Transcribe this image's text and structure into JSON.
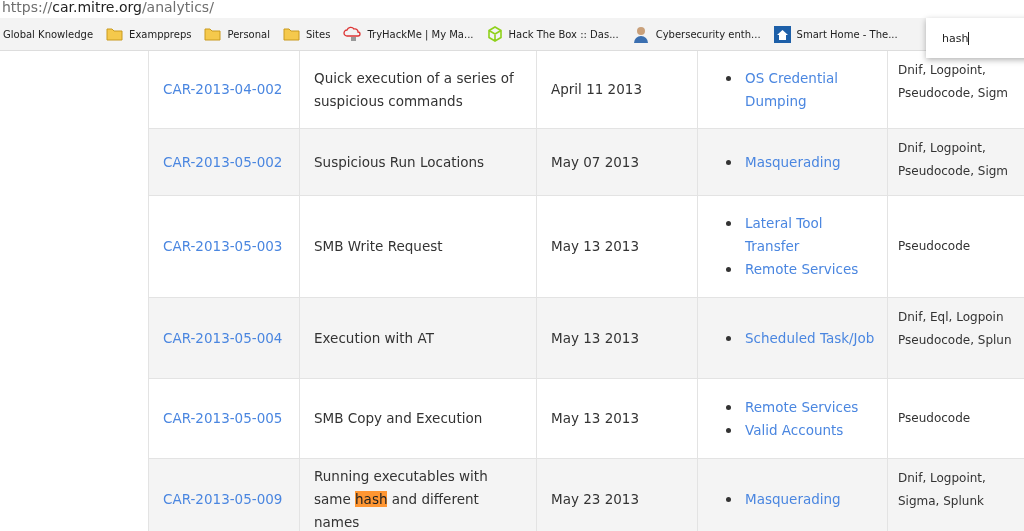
{
  "address_bar": {
    "scheme": "https://",
    "host": "car.mitre.org",
    "path": "/analytics/"
  },
  "bookmarks": [
    {
      "kind": "none",
      "label": "Global Knowledge"
    },
    {
      "kind": "folder",
      "label": "Examppreps"
    },
    {
      "kind": "folder",
      "label": "Personal"
    },
    {
      "kind": "folder",
      "label": "Sites"
    },
    {
      "kind": "cloud",
      "label": "TryHackMe | My Ma..."
    },
    {
      "kind": "cube",
      "label": "Hack The Box :: Das..."
    },
    {
      "kind": "avatar",
      "label": "Cybersecurity enth..."
    },
    {
      "kind": "house",
      "label": "Smart Home - The..."
    }
  ],
  "find_bar": {
    "value": "hash"
  },
  "table": {
    "rows": [
      {
        "id": "CAR-2013-04-002",
        "description": {
          "text": "Quick execution of a series of suspicious commands"
        },
        "date": "April 11 2013",
        "techniques": [
          "OS Credential Dumping"
        ],
        "implementations": [
          "Dnif, Logpoint,",
          "Pseudocode, Sigm"
        ]
      },
      {
        "id": "CAR-2013-05-002",
        "description": {
          "text": "Suspicious Run Locations"
        },
        "date": "May 07 2013",
        "techniques": [
          "Masquerading"
        ],
        "implementations": [
          "Dnif, Logpoint,",
          "Pseudocode, Sigm"
        ]
      },
      {
        "id": "CAR-2013-05-003",
        "description": {
          "text": "SMB Write Request"
        },
        "date": "May 13 2013",
        "techniques": [
          "Lateral Tool Transfer",
          "Remote Services"
        ],
        "implementations": [
          "Pseudocode"
        ]
      },
      {
        "id": "CAR-2013-05-004",
        "description": {
          "text": "Execution with AT"
        },
        "date": "May 13 2013",
        "techniques": [
          "Scheduled Task/Job"
        ],
        "implementations": [
          "Dnif, Eql, Logpoin",
          "Pseudocode, Splun"
        ]
      },
      {
        "id": "CAR-2013-05-005",
        "description": {
          "text": "SMB Copy and Execution"
        },
        "date": "May 13 2013",
        "techniques": [
          "Remote Services",
          "Valid Accounts"
        ],
        "implementations": [
          "Pseudocode"
        ]
      },
      {
        "id": "CAR-2013-05-009",
        "description": {
          "text": "Running executables with same ",
          "match": "hash",
          "after": " and different names"
        },
        "date": "May 23 2013",
        "techniques": [
          "Masquerading"
        ],
        "implementations": [
          "Dnif, Logpoint,",
          "Sigma, Splunk"
        ]
      }
    ]
  }
}
